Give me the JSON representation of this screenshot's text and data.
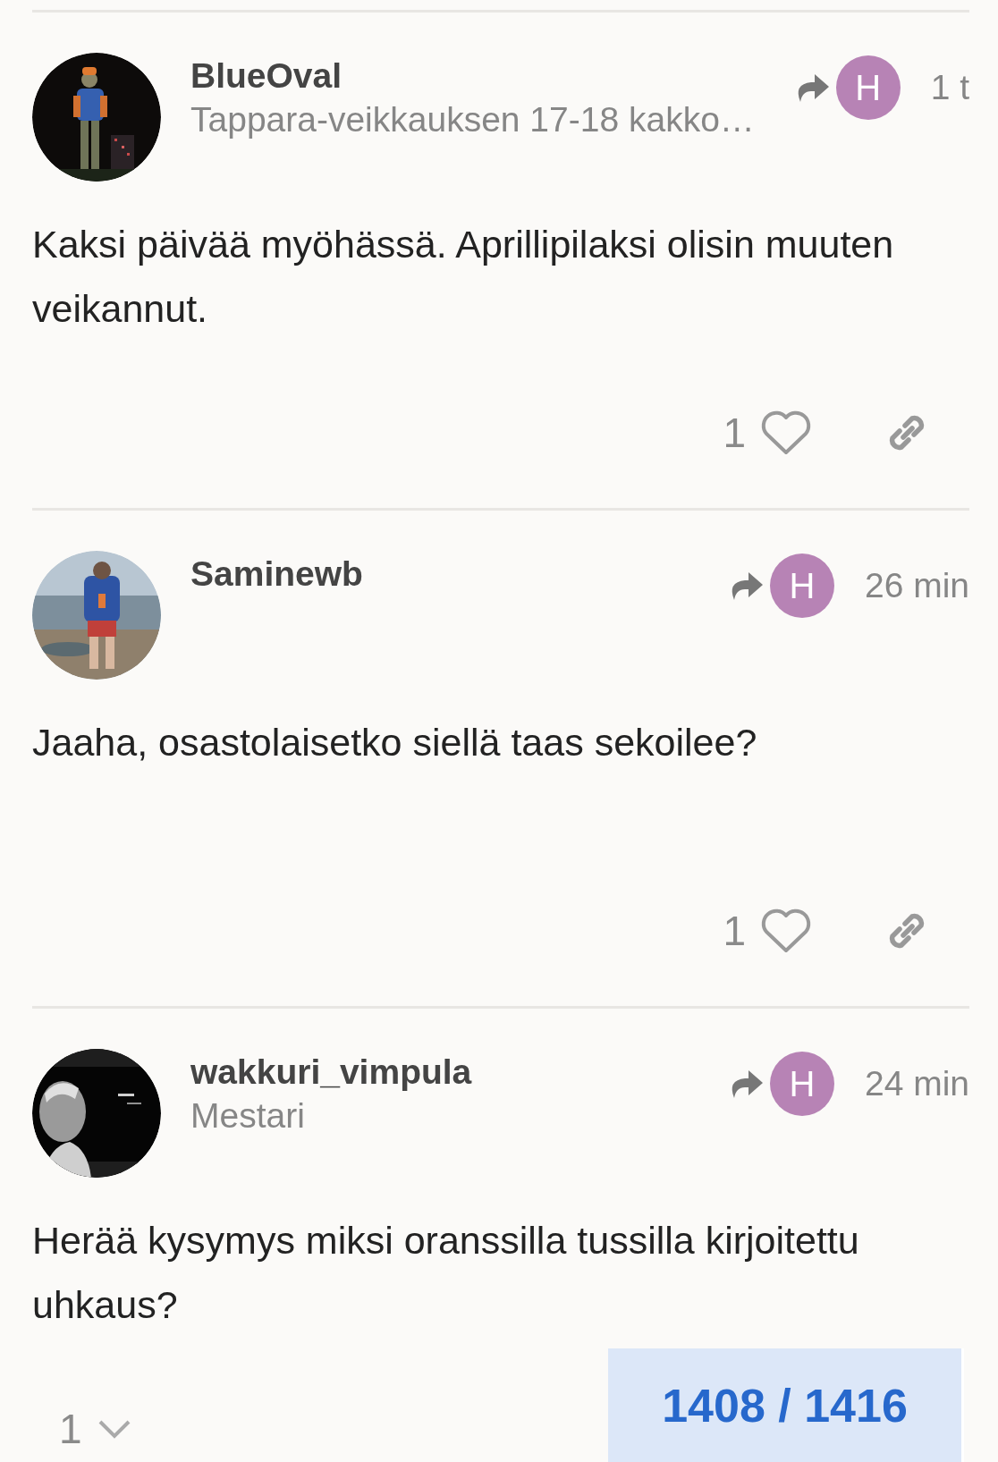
{
  "posts": [
    {
      "username": "BlueOval",
      "subtitle": "Tappara-veikkauksen 17-18 kakko…",
      "reply_to": {
        "letter": "H",
        "color": "#b783b5"
      },
      "time": "1 t",
      "body": "Kaksi päivää myöhässä. Aprillipilaksi olisin muuten veikannut.",
      "actions": {
        "kind": "likes",
        "count": "1"
      }
    },
    {
      "username": "Saminewb",
      "reply_to": {
        "letter": "H",
        "color": "#b783b5"
      },
      "time": "26 min",
      "body": "Jaaha, osastolaisetko siellä taas sekoilee?",
      "actions": {
        "kind": "likes",
        "count": "1"
      }
    },
    {
      "username": "wakkuri_vimpula",
      "subtitle": "Mestari",
      "reply_to": {
        "letter": "H",
        "color": "#b783b5"
      },
      "time": "24 min",
      "body": "Herää kysymys miksi oranssilla tussilla kirjoitettu uhkaus?",
      "actions": {
        "kind": "replies",
        "count": "1"
      }
    }
  ],
  "progress": {
    "label": "1408 / 1416"
  }
}
